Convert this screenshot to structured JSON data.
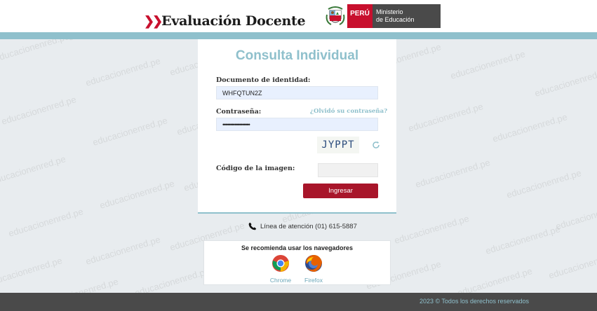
{
  "header": {
    "brand": "Evaluación Docente",
    "country_badge": "PERÚ",
    "ministry_line1": "Ministerio",
    "ministry_line2": "de Educación"
  },
  "form": {
    "title": "Consulta Individual",
    "doc_label": "Documento de identidad:",
    "doc_value": "WHFQTUN2Z",
    "password_label": "Contraseña:",
    "password_value": "••••••••••••••••••",
    "forgot_link": "¿Olvidó su contraseña?",
    "captcha_text": "JYPPT",
    "image_code_label": "Código de la imagen:",
    "image_code_value": "",
    "submit_label": "Ingresar"
  },
  "contact": {
    "phone_text": "Línea de atención (01) 615-5887"
  },
  "browsers": {
    "title": "Se recomienda usar los navegadores",
    "items": [
      {
        "name": "Chrome",
        "icon": "chrome-icon"
      },
      {
        "name": "Firefox",
        "icon": "firefox-icon"
      }
    ]
  },
  "footer": {
    "copyright": "2023 © Todos los derechos reservados"
  },
  "watermark": "educacionenred.pe",
  "colors": {
    "accent_teal": "#8fc0cc",
    "brand_red": "#c8102e",
    "button_red": "#a8152a",
    "footer_gray": "#4a4a4a"
  }
}
